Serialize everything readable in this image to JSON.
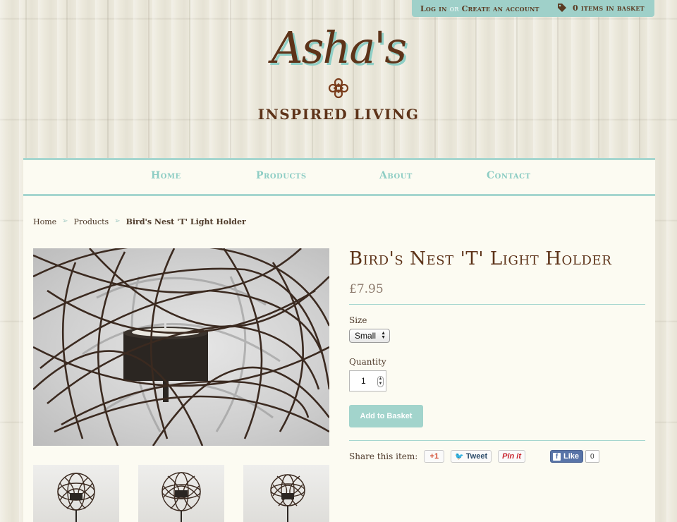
{
  "header": {
    "login_label": "Log in",
    "or_label": "or",
    "create_account_label": "Create an account",
    "basket_label": "0 items in basket"
  },
  "logo": {
    "script_text": "Asha's",
    "tagline": "INSPIRED LIVING"
  },
  "nav": {
    "items": [
      {
        "label": "Home"
      },
      {
        "label": "Products"
      },
      {
        "label": "About"
      },
      {
        "label": "Contact"
      }
    ]
  },
  "breadcrumb": {
    "home": "Home",
    "separator": "➢",
    "products": "Products",
    "current": "Bird's Nest 'T' Light Holder"
  },
  "product": {
    "title": "Bird's Nest 'T' Light Holder",
    "price": "£7.95",
    "size_label": "Size",
    "size_value": "Small",
    "quantity_label": "Quantity",
    "quantity_value": "1",
    "add_button": "Add to Basket"
  },
  "share": {
    "label": "Share this item:",
    "gplus": "+1",
    "tweet": "Tweet",
    "pin": "Pin it",
    "like": "Like",
    "like_count": "0"
  },
  "colors": {
    "accent": "#a5d6cf",
    "brown": "#5d3319",
    "panel": "#fcfbf2"
  }
}
